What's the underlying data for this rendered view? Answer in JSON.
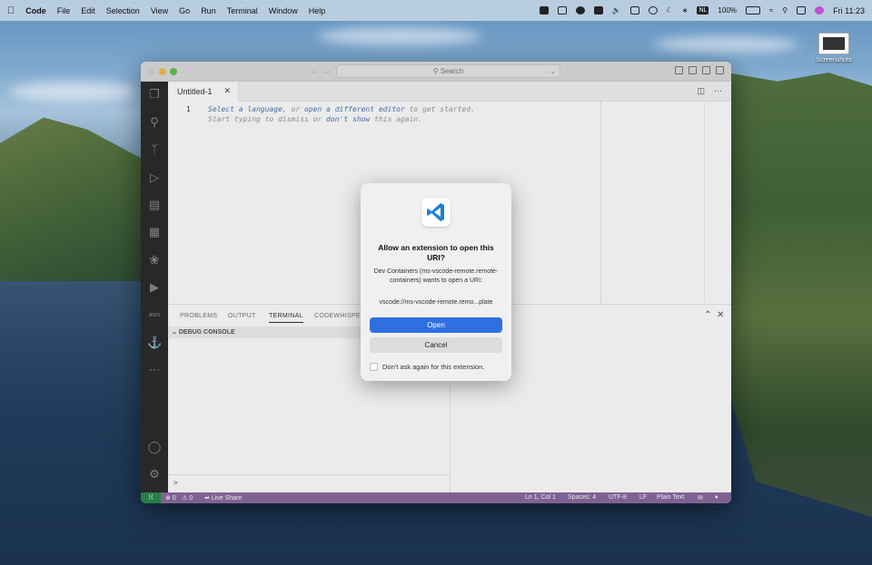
{
  "menubar": {
    "app": "Code",
    "items": [
      "File",
      "Edit",
      "Selection",
      "View",
      "Go",
      "Run",
      "Terminal",
      "Window",
      "Help"
    ],
    "battery": "100%",
    "input_source": "NL",
    "clock": "Fri 11:23"
  },
  "desktop": {
    "screenshots_label": "Screenshots"
  },
  "window": {
    "search_label": "Search",
    "tab_label": "Untitled-1",
    "line_number": "1",
    "hint_line1": {
      "a": "Select a language",
      "b": ", or ",
      "c": "open a different editor",
      "d": " to get started."
    },
    "hint_line2": {
      "a": "Start typing to dismiss or ",
      "b": "don't show",
      "c": " this again."
    }
  },
  "panel": {
    "tabs": [
      "PROBLEMS",
      "OUTPUT",
      "TERMINAL",
      "CODEWHISPER"
    ],
    "active_tab": "TERMINAL",
    "debug_header": "DEBUG CONSOLE",
    "prompt": ">"
  },
  "statusbar": {
    "remote": "⟩⟨",
    "errors": "⊗ 0",
    "warnings": "⚠ 0",
    "live_share": "Live Share",
    "position": "Ln 1, Col 1",
    "spaces": "Spaces: 4",
    "encoding": "UTF-8",
    "eol": "LF",
    "language": "Plain Text"
  },
  "dialog": {
    "title": "Allow an extension to open this URI?",
    "message": "Dev Containers (ms-vscode-remote.remote-containers) wants to open a URI:",
    "uri": "vscode://ms-vscode-remote.remo...plate",
    "open_label": "Open",
    "cancel_label": "Cancel",
    "checkbox_label": "Don't ask again for this extension."
  }
}
